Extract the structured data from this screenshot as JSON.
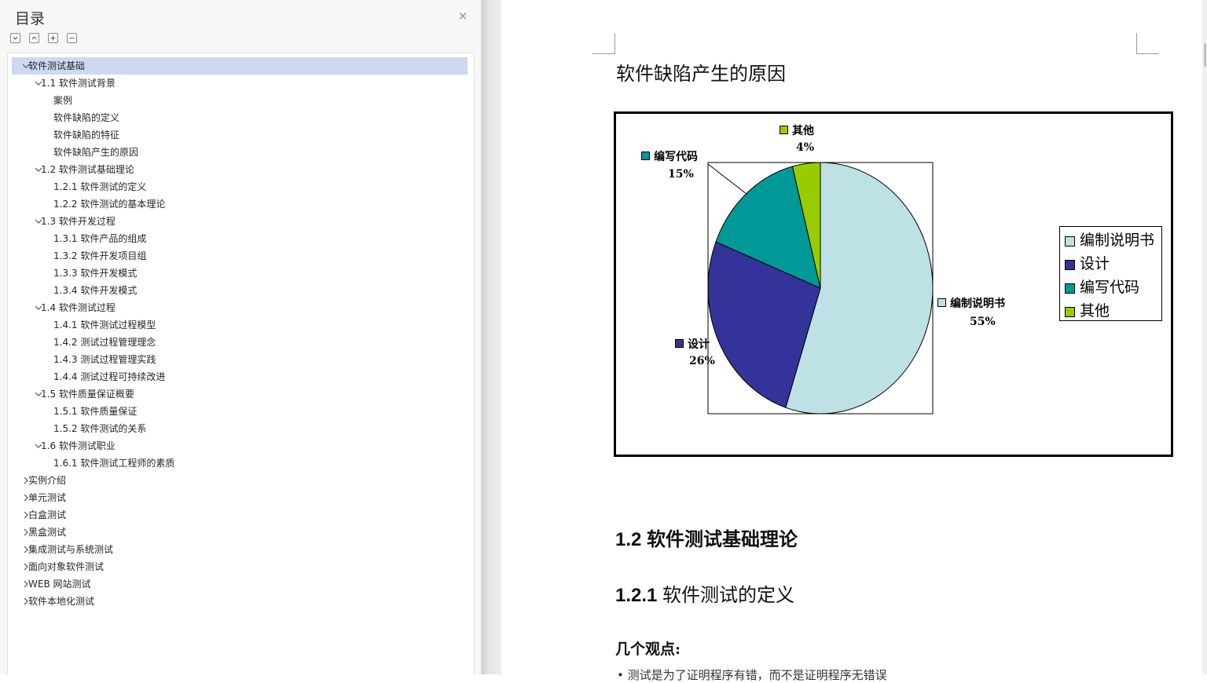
{
  "toc": {
    "title": "目录",
    "close_glyph": "×",
    "toolbar": [
      "expand-all-icon",
      "collapse-all-icon",
      "plus-icon",
      "minus-icon"
    ],
    "items": [
      {
        "label": "软件测试基础",
        "level": 0,
        "chevron": "down",
        "selected": true
      },
      {
        "label": "1.1 软件测试背景",
        "level": 1,
        "chevron": "down"
      },
      {
        "label": "案例",
        "level": 2
      },
      {
        "label": "软件缺陷的定义",
        "level": 2
      },
      {
        "label": "软件缺陷的特征",
        "level": 2
      },
      {
        "label": "软件缺陷产生的原因",
        "level": 2
      },
      {
        "label": "1.2  软件测试基础理论",
        "level": 1,
        "chevron": "down"
      },
      {
        "label": "1.2.1 软件测试的定义",
        "level": 2
      },
      {
        "label": "1.2.2 软件测试的基本理论",
        "level": 2
      },
      {
        "label": "1.3 软件开发过程",
        "level": 1,
        "chevron": "down"
      },
      {
        "label": "1.3.1 软件产品的组成",
        "level": 2
      },
      {
        "label": "1.3.2 软件开发项目组",
        "level": 2
      },
      {
        "label": "1.3.3 软件开发模式",
        "level": 2
      },
      {
        "label": "1.3.4 软件开发模式",
        "level": 2
      },
      {
        "label": "1.4 软件测试过程",
        "level": 1,
        "chevron": "down"
      },
      {
        "label": "1.4.1 软件测试过程模型",
        "level": 2
      },
      {
        "label": "1.4.2 测试过程管理理念",
        "level": 2
      },
      {
        "label": "1.4.3 测试过程管理实践",
        "level": 2
      },
      {
        "label": "1.4.4 测试过程可持续改进",
        "level": 2
      },
      {
        "label": "1.5 软件质量保证概要",
        "level": 1,
        "chevron": "down"
      },
      {
        "label": "1.5.1 软件质量保证",
        "level": 2
      },
      {
        "label": "1.5.2 软件测试的关系",
        "level": 2
      },
      {
        "label": "1.6 软件测试职业",
        "level": 1,
        "chevron": "down"
      },
      {
        "label": "1.6.1 软件测试工程师的素质",
        "level": 2
      },
      {
        "label": "实例介绍",
        "level": 0,
        "chevron": "right"
      },
      {
        "label": "单元测试",
        "level": 0,
        "chevron": "right"
      },
      {
        "label": "白盒测试",
        "level": 0,
        "chevron": "right"
      },
      {
        "label": "黑盒测试",
        "level": 0,
        "chevron": "right"
      },
      {
        "label": "集成测试与系统测试",
        "level": 0,
        "chevron": "right"
      },
      {
        "label": "面向对象软件测试",
        "level": 0,
        "chevron": "right"
      },
      {
        "label": "WEB 网站测试",
        "level": 0,
        "chevron": "right"
      },
      {
        "label": "软件本地化测试",
        "level": 0,
        "chevron": "right"
      }
    ]
  },
  "document": {
    "heading": "软件缺陷产生的原因",
    "section_12": "1.2  软件测试基础理论",
    "section_121_num": "1.2.1",
    "section_121_text": " 软件测试的定义",
    "para_views": "几个观点:",
    "bullet_cut": "•   测试是为了证明程序有错，而不是证明程序无错误"
  },
  "chart_data": {
    "type": "pie",
    "categories": [
      "编制说明书",
      "设计",
      "编写代码",
      "其他"
    ],
    "values": [
      55,
      26,
      15,
      4
    ],
    "labels": [
      "55%",
      "26%",
      "15%",
      "4%"
    ],
    "colors": [
      "#bde1e4",
      "#33339a",
      "#009998",
      "#99cc00"
    ],
    "legend": "right",
    "title": ""
  }
}
